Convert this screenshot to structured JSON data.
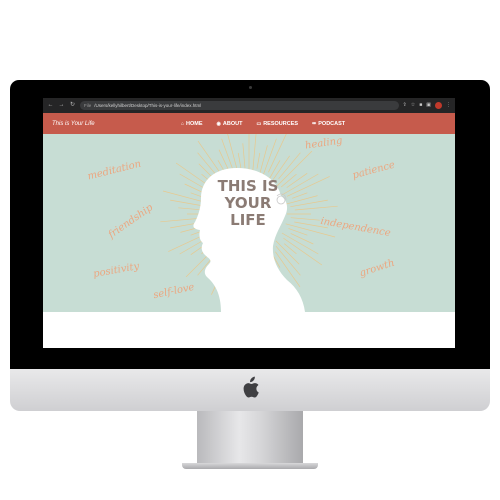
{
  "browser": {
    "url_info": "File",
    "url": "/Users/kellyhilbert/Desktop/This-is-your-life/index.html"
  },
  "site": {
    "title": "This is Your Life",
    "menu": [
      {
        "label": "HOME",
        "icon": "home-icon"
      },
      {
        "label": "ABOUT",
        "icon": "user-circle-icon"
      },
      {
        "label": "RESOURCES",
        "icon": "book-icon"
      },
      {
        "label": "PODCAST",
        "icon": "microphone-icon"
      }
    ]
  },
  "hero": {
    "title_lines": [
      "THIS IS",
      "YOUR",
      "LIFE"
    ],
    "words": [
      "meditation",
      "healing",
      "patience",
      "friendship",
      "independence",
      "positivity",
      "growth",
      "self-love"
    ]
  },
  "colors": {
    "nav": "#c65b4c",
    "hero_bg": "#c7ddd4",
    "word": "#eba781",
    "rays": "#e7c98f",
    "title": "#8b7b74"
  }
}
